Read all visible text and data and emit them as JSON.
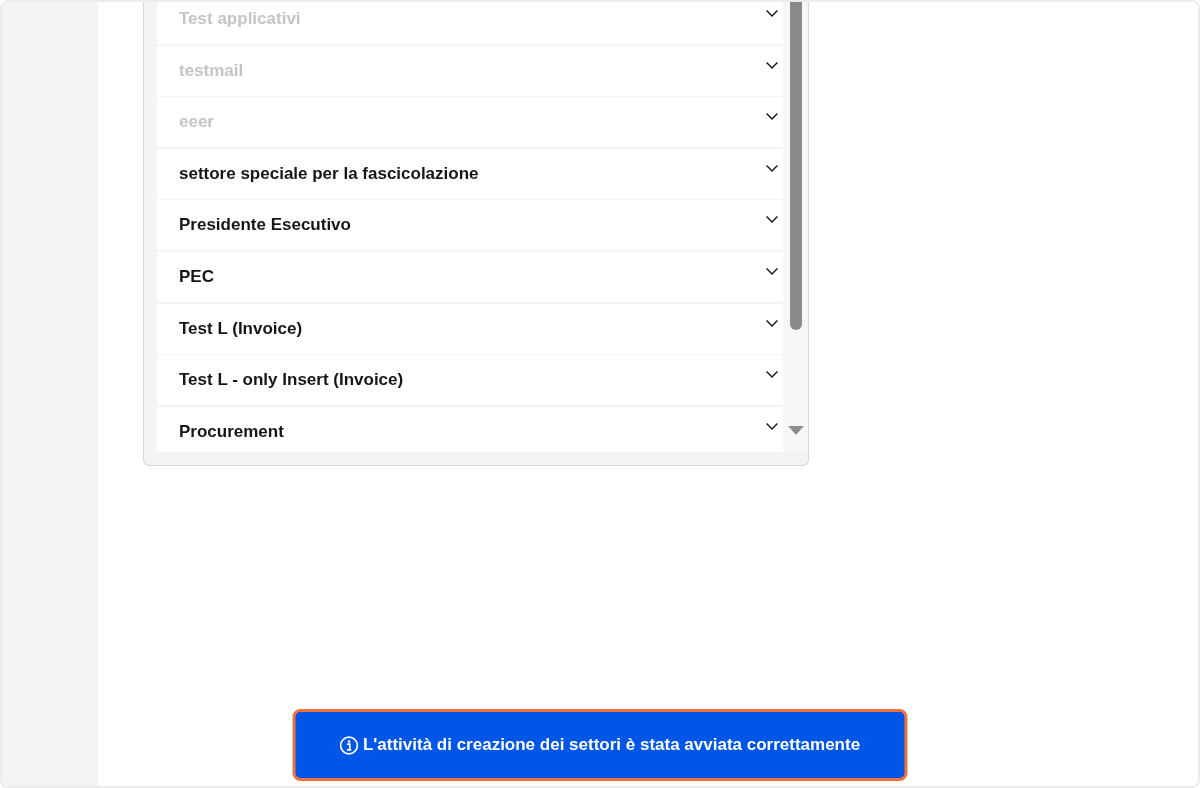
{
  "list": {
    "items": [
      {
        "label": "Test applicativi",
        "disabled": true
      },
      {
        "label": "testmail",
        "disabled": true
      },
      {
        "label": "eeer",
        "disabled": true
      },
      {
        "label": "settore speciale per la fascicolazione",
        "disabled": false
      },
      {
        "label": "Presidente Esecutivo",
        "disabled": false
      },
      {
        "label": "PEC",
        "disabled": false
      },
      {
        "label": "Test L (Invoice)",
        "disabled": false
      },
      {
        "label": "Test L - only Insert (Invoice)",
        "disabled": false
      },
      {
        "label": "Procurement",
        "disabled": false
      }
    ]
  },
  "toast": {
    "message": "L'attività di creazione dei settori è stata avviata correttamente"
  }
}
